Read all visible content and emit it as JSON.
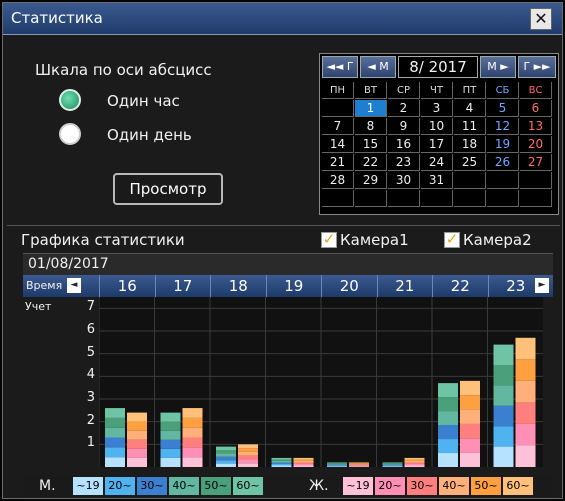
{
  "window": {
    "title": "Статистика",
    "close_symbol": "✕"
  },
  "axis_scale": {
    "label": "Шкала по оси абсцисс",
    "options": [
      {
        "label": "Один час",
        "selected": true
      },
      {
        "label": "Один день",
        "selected": false
      }
    ]
  },
  "view_button": {
    "label": "Просмотр"
  },
  "calendar": {
    "month_label": "8/ 2017",
    "nav": {
      "prev_year": "◄◄ Г",
      "prev_month": "◄ М",
      "next_month": "М ►",
      "next_year": "Г ►►"
    },
    "weekdays": [
      "ПН",
      "ВТ",
      "СР",
      "ЧТ",
      "ПТ",
      "СБ",
      "ВС"
    ],
    "weeks": [
      [
        "",
        "1",
        "2",
        "3",
        "4",
        "5",
        "6"
      ],
      [
        "7",
        "8",
        "9",
        "10",
        "11",
        "12",
        "13"
      ],
      [
        "14",
        "15",
        "16",
        "17",
        "18",
        "19",
        "20"
      ],
      [
        "21",
        "22",
        "23",
        "24",
        "25",
        "26",
        "27"
      ],
      [
        "28",
        "29",
        "30",
        "31",
        "",
        "",
        ""
      ],
      [
        "",
        "",
        "",
        "",
        "",
        "",
        ""
      ]
    ],
    "selected_day": "1"
  },
  "section": {
    "title": "Графика статистики",
    "cameras": [
      {
        "label": "Камера1",
        "checked": true
      },
      {
        "label": "Камера2",
        "checked": true
      }
    ]
  },
  "date": "01/08/2017",
  "time_label": "Время",
  "count_label": "Учет",
  "hours": [
    "16",
    "17",
    "18",
    "19",
    "20",
    "21",
    "22",
    "23"
  ],
  "yticks": [
    "1",
    "2",
    "3",
    "4",
    "5",
    "6",
    "7"
  ],
  "legend": {
    "male_label": "М.",
    "female_label": "Ж.",
    "age_groups": [
      "~19",
      "20~",
      "30~",
      "40~",
      "50~",
      "60~"
    ],
    "male_colors": [
      "#b6e2ff",
      "#4fb3f0",
      "#3b80d0",
      "#62b7a0",
      "#4aa07a",
      "#6ec4a5"
    ],
    "female_colors": [
      "#ffc1d8",
      "#ff8fb4",
      "#ff7f7f",
      "#ffb07a",
      "#ffa040",
      "#ffc07a"
    ]
  },
  "chart_data": {
    "type": "bar",
    "categories": [
      "16",
      "17",
      "18",
      "19",
      "20",
      "21",
      "22",
      "23"
    ],
    "ylim": [
      0,
      7.5
    ],
    "series": [
      {
        "name": "М.",
        "values": [
          2.6,
          2.4,
          0.9,
          0.4,
          0.2,
          0.2,
          3.7,
          5.4
        ]
      },
      {
        "name": "Ж.",
        "values": [
          2.4,
          2.6,
          1.0,
          0.4,
          0.2,
          0.4,
          3.8,
          5.7
        ]
      }
    ]
  }
}
